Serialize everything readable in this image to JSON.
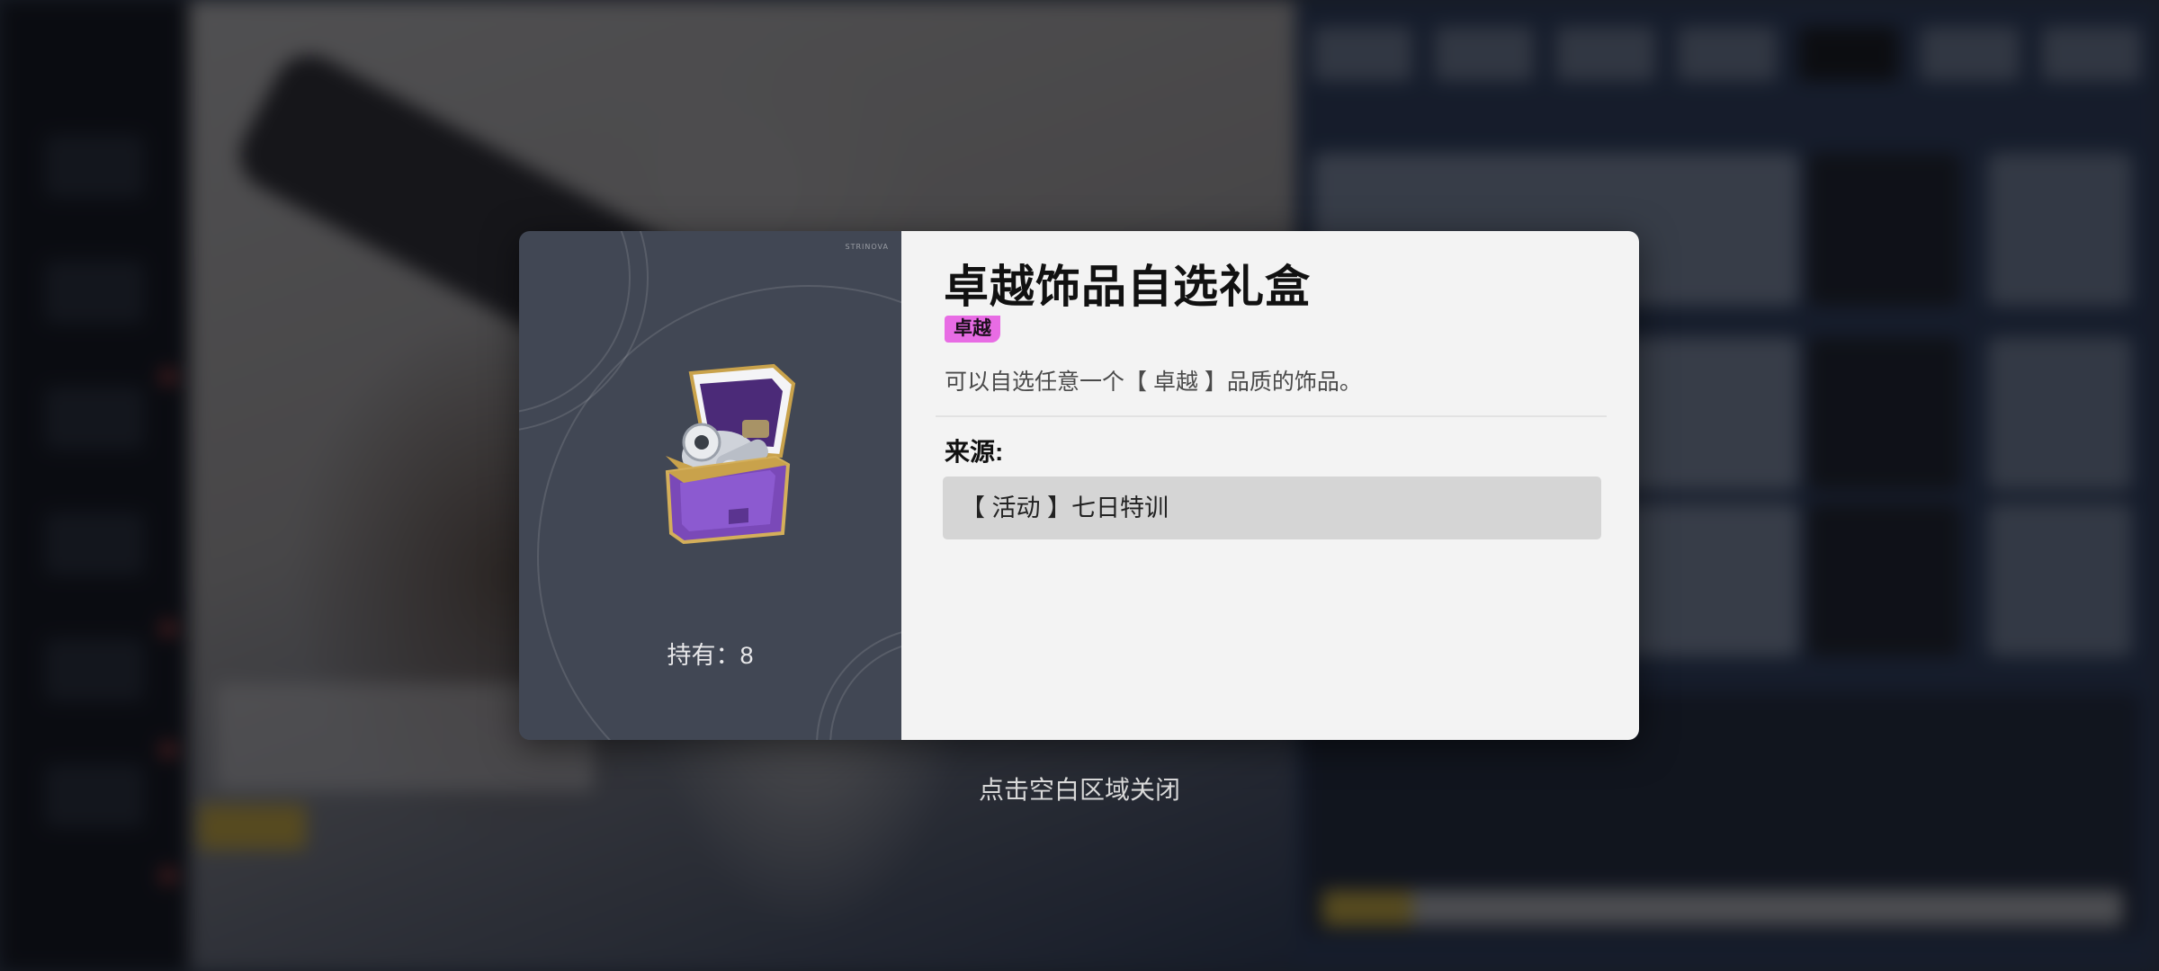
{
  "modal": {
    "item_name": "卓越饰品自选礼盒",
    "rarity": "卓越",
    "description": "可以自选任意一个【 卓越 】品质的饰品。",
    "owned_text": "持有：8",
    "source_label": "来源:",
    "sources": [
      "【 活动 】七日特训"
    ],
    "item_icon": "gift-chest-icon",
    "brand_mark": "STRINOVA"
  },
  "close_hint": "点击空白区域关闭",
  "colors": {
    "rarity_badge": "#e86ce4",
    "panel_left": "#414754",
    "panel_right": "#f3f3f3",
    "source_bg": "#d5d5d5"
  }
}
